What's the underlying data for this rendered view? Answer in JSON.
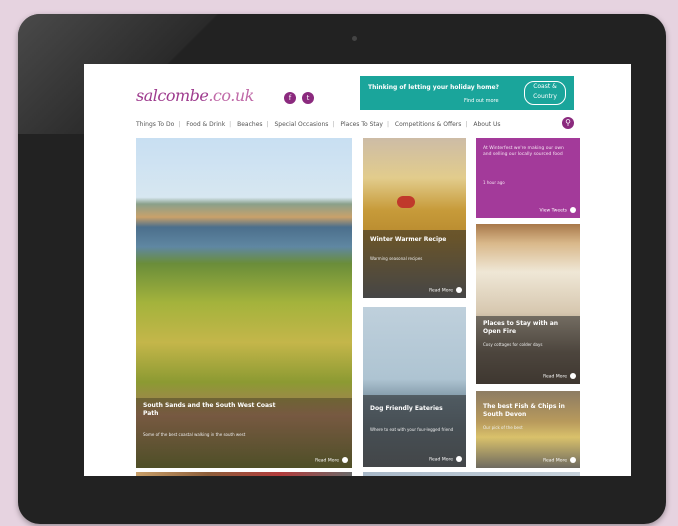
{
  "site": {
    "logo_prefix": "salcombe",
    "logo_suffix": ".co.uk",
    "social_icons": [
      "facebook-icon",
      "twitter-icon"
    ]
  },
  "banner": {
    "text": "Thinking of letting your holiday home?",
    "sub": "Find out more",
    "brand": "Coast & Country"
  },
  "nav": {
    "items": [
      "Things To Do",
      "Food & Drink",
      "Beaches",
      "Special Occasions",
      "Places To Stay",
      "Competitions & Offers",
      "About Us"
    ]
  },
  "tiles": {
    "hero": {
      "title": "South Sands and the South West Coast Path",
      "desc": "Some of the best coastal walking in the south west",
      "more": "Read More"
    },
    "soup": {
      "title": "Winter Warmer Recipe",
      "desc": "Warming seasonal recipes",
      "more": "Read More"
    },
    "promo": {
      "title": "At Winterfest we're making our own and selling our locally sourced food",
      "desc": "1 hour ago",
      "more": "View Tweets"
    },
    "fire": {
      "title": "Places to Stay with an Open Fire",
      "desc": "Cosy cottages for colder days",
      "more": "Read More"
    },
    "dog": {
      "title": "Dog Friendly Eateries",
      "desc": "Where to eat with your four-legged friend",
      "more": "Read More"
    },
    "fish": {
      "title": "The best Fish & Chips in South Devon",
      "desc": "Our pick of the best",
      "more": "Read More"
    }
  }
}
